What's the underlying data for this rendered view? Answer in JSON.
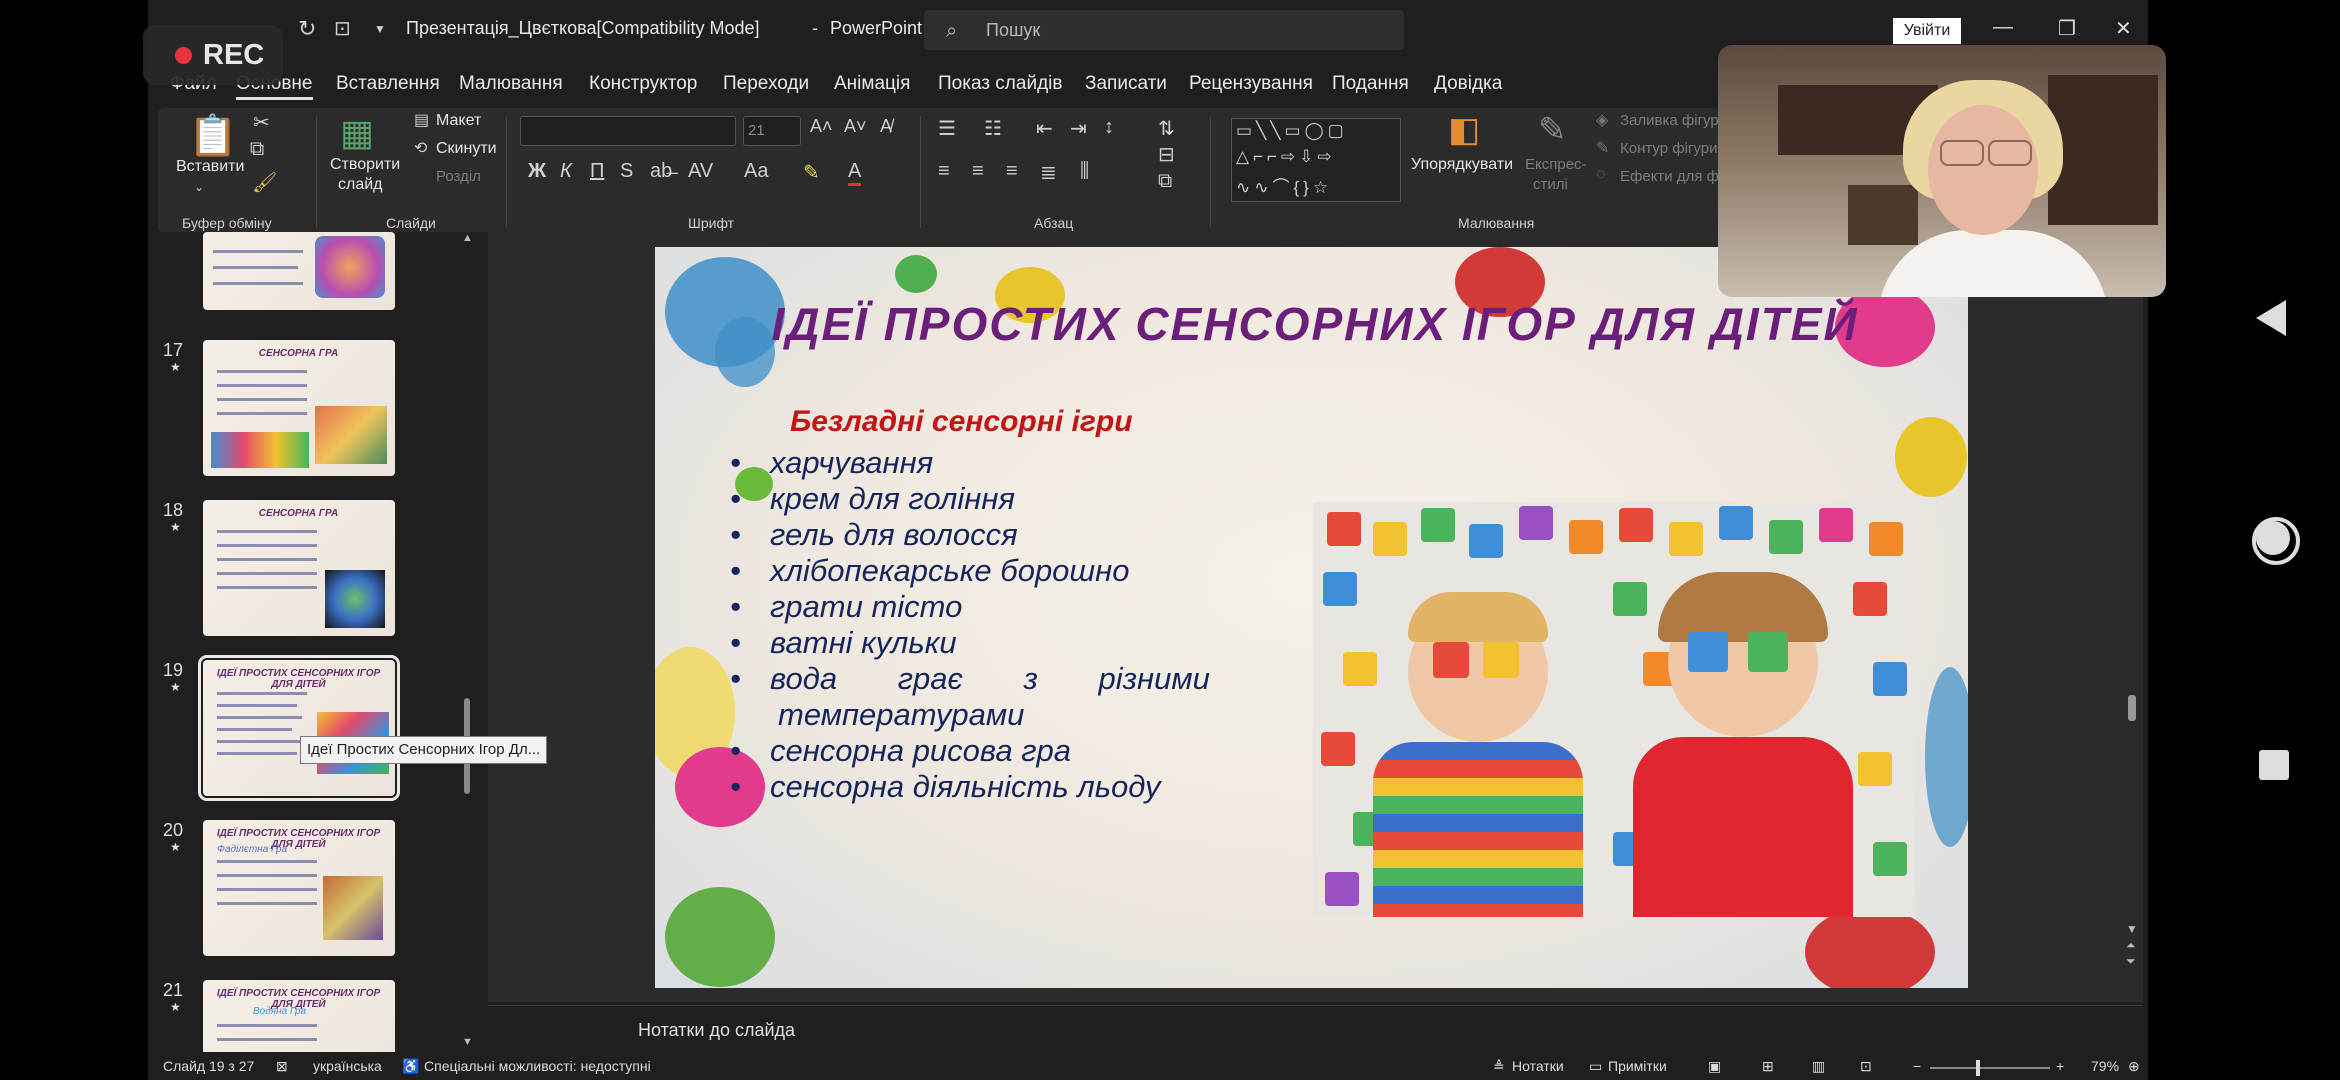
{
  "recording": {
    "label": "REC"
  },
  "titlebar": {
    "document_title": "Презентація_Цвєткова[Compatibility Mode]",
    "separator": "-",
    "app_name": "PowerPoint",
    "search_placeholder": "Пошук",
    "login_label": "Увійти"
  },
  "menu": {
    "items": [
      "Файл",
      "Основне",
      "Вставлення",
      "Малювання",
      "Конструктор",
      "Переходи",
      "Анімація",
      "Показ слайдів",
      "Записати",
      "Рецензування",
      "Подання",
      "Довідка"
    ]
  },
  "ribbon": {
    "clipboard": {
      "paste_label": "Вставити",
      "group_label": "Буфер обміну"
    },
    "slides": {
      "new_slide_label": "Створити",
      "new_slide_label2": "слайд",
      "layout_label": "Макет",
      "reset_label": "Скинути",
      "section_label": "Розділ",
      "group_label": "Слайди"
    },
    "font": {
      "font_size": "21",
      "group_label": "Шрифт"
    },
    "paragraph": {
      "group_label": "Абзац"
    },
    "drawing": {
      "arrange_label": "Упорядкувати",
      "quick_styles_label": "Експрес-",
      "quick_styles_label2": "стилі",
      "fill_label": "Заливка фігури",
      "outline_label": "Контур фігури",
      "effects_label": "Ефекти для фігури",
      "group_label": "Малювання"
    }
  },
  "slides_panel": {
    "thumbnails": [
      {
        "number": "17",
        "title": "СЕНСОРНА ГРА"
      },
      {
        "number": "18",
        "title": "СЕНСОРНА ГРА"
      },
      {
        "number": "19",
        "title": "ІДЕЇ ПРОСТИХ СЕНСОРНИХ ІГОР ДЛЯ ДІТЕЙ"
      },
      {
        "number": "20",
        "title": "ІДЕЇ ПРОСТИХ СЕНСОРНИХ ІГОР ДЛЯ ДІТЕЙ",
        "subtitle": "Фаділєтна Гра"
      },
      {
        "number": "21",
        "title": "ІДЕЇ ПРОСТИХ СЕНСОРНИХ ІГОР ДЛЯ ДІТЕЙ",
        "subtitle": "Водяна Гра"
      }
    ],
    "tooltip": "Ідеї Простих Сенсорних Ігор Дл..."
  },
  "slide": {
    "title": "ІДЕЇ ПРОСТИХ СЕНСОРНИХ ІГОР ДЛЯ ДІТЕЙ",
    "subtitle": "Безладні сенсорні ігри",
    "bullets": [
      "харчування",
      "крем для гоління",
      "гель для волосся",
      "хлібопекарське борошно",
      "грати тісто",
      "ватні кульки",
      "вода грає з різними",
      "температурами",
      "сенсорна рисова гра",
      "сенсорна діяльність льоду"
    ]
  },
  "notes": {
    "label": "Нотатки до слайда"
  },
  "status": {
    "slide_counter": "Слайд 19 з 27",
    "language": "українська",
    "accessibility": "Спеціальні можливості: недоступні",
    "notes_button": "Нотатки",
    "comments_button": "Примітки",
    "zoom": "79%"
  },
  "colors": {
    "title": "#6b1f7a",
    "subtitle": "#c31515",
    "bullets": "#16255e",
    "recording": "#e8323c"
  }
}
